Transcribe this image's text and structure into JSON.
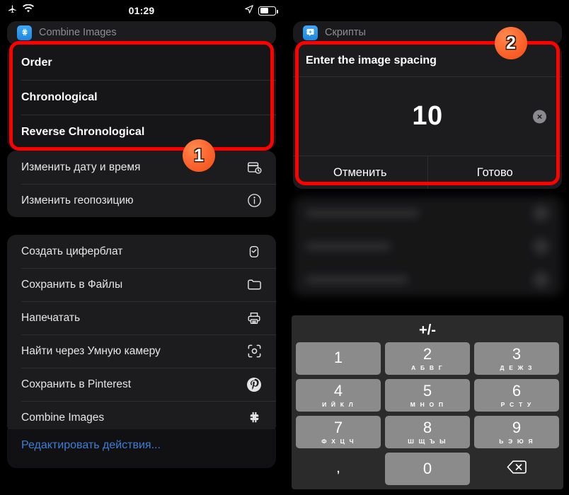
{
  "status_bar": {
    "airplane_icon": "airplane-icon",
    "wifi_icon": "wifi-icon",
    "time": "01:29",
    "location_icon": "location-arrow-icon",
    "battery_icon": "battery-icon"
  },
  "left_panel": {
    "sheet_header": {
      "app_icon": "combine-images-icon",
      "title": "Combine Images"
    },
    "order_menu": {
      "items": [
        {
          "label": "Order"
        },
        {
          "label": "Chronological"
        },
        {
          "label": "Reverse Chronological"
        }
      ]
    },
    "actions_group_1": [
      {
        "label": "Изменить дату и время",
        "icon": "calendar-clock-icon"
      },
      {
        "label": "Изменить геопозицию",
        "icon": "location-info-icon"
      }
    ],
    "actions_group_2": [
      {
        "label": "Создать циферблат",
        "icon": "watch-face-icon"
      },
      {
        "label": "Сохранить в Файлы",
        "icon": "folder-icon"
      },
      {
        "label": "Напечатать",
        "icon": "printer-icon"
      },
      {
        "label": "Найти через Умную камеру",
        "icon": "smart-camera-icon"
      },
      {
        "label": "Сохранить в Pinterest",
        "icon": "pinterest-icon"
      },
      {
        "label": "Combine Images",
        "icon": "puzzle-icon"
      }
    ],
    "edit_actions_link": "Редактировать действия..."
  },
  "right_panel": {
    "sheet_header": {
      "app_icon": "scripts-icon",
      "title": "Скрипты"
    },
    "dialog": {
      "prompt": "Enter the image spacing",
      "value": "10",
      "clear_icon": "clear-circle-icon",
      "cancel_label": "Отменить",
      "done_label": "Готово"
    },
    "keyboard": {
      "plus_minus_label": "+/-",
      "keys": [
        {
          "num": "1",
          "sub": ""
        },
        {
          "num": "2",
          "sub": "А Б В Г"
        },
        {
          "num": "3",
          "sub": "Д Е Ж З"
        },
        {
          "num": "4",
          "sub": "И Й К Л"
        },
        {
          "num": "5",
          "sub": "М Н О П"
        },
        {
          "num": "6",
          "sub": "Р С Т У"
        },
        {
          "num": "7",
          "sub": "Ф Х Ц Ч"
        },
        {
          "num": "8",
          "sub": "Ш Щ Ъ Ы"
        },
        {
          "num": "9",
          "sub": "Ь Э Ю Я"
        }
      ],
      "comma_label": ",",
      "zero_label": "0",
      "backspace_icon": "backspace-icon"
    }
  },
  "annotations": {
    "badge_1": "1",
    "badge_2": "2",
    "highlight_color": "#fe0000",
    "badge_color": "#fc6b34"
  }
}
